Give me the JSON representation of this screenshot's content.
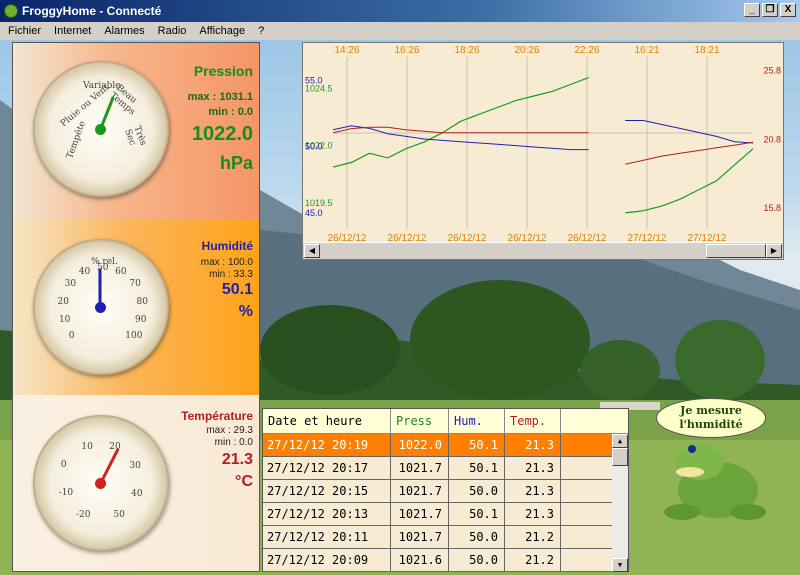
{
  "window": {
    "title": "FroggyHome - Connecté",
    "buttons": [
      "_",
      "❐",
      "X"
    ]
  },
  "menu": [
    "Fichier",
    "Internet",
    "Alarmes",
    "Radio",
    "Affichage",
    "?"
  ],
  "pressure": {
    "title": "Pression",
    "max": "max : 1031.1",
    "min": "min : 0.0",
    "value": "1022.0",
    "unit": "hPa",
    "dial_words": [
      "Tempête",
      "Pluie ou Vent",
      "Variable",
      "Beau Temps",
      "Très Sec"
    ]
  },
  "humidity": {
    "title": "Humidité",
    "max": "max : 100.0",
    "min": "min : 33.3",
    "value": "50.1",
    "unit": "%",
    "dial_label": "% rel.",
    "ticks": [
      "0",
      "10",
      "20",
      "30",
      "40",
      "50",
      "60",
      "70",
      "80",
      "90",
      "100"
    ]
  },
  "temperature": {
    "title": "Température",
    "max": "max : 29.3",
    "min": "min : 0.0",
    "value": "21.3",
    "unit": "°C",
    "ticks": [
      "-20",
      "-10",
      "0",
      "10",
      "20",
      "30",
      "40",
      "50"
    ]
  },
  "chart_data": {
    "type": "line",
    "top_times": [
      "14:26",
      "16:26",
      "18:26",
      "20:26",
      "22:26",
      "16:21",
      "18:21"
    ],
    "bottom_dates": [
      "26/12/12",
      "26/12/12",
      "26/12/12",
      "26/12/12",
      "26/12/12",
      "27/12/12",
      "27/12/12"
    ],
    "left_labels": {
      "pressure": [
        "1024.5",
        "1022.0",
        "1019.5"
      ],
      "humidity": [
        "55.0",
        "50.0",
        "45.0"
      ]
    },
    "right_labels": [
      "25.8",
      "20.8",
      "15.8"
    ],
    "colors": {
      "pressure": "#1a9a1a",
      "humidity": "#2020b0",
      "temperature": "#b02020"
    },
    "series": [
      {
        "name": "Press",
        "values": [
          1021.2,
          1021.4,
          1021.8,
          1021.6,
          1022.0,
          1022.3,
          1022.7,
          1023.2,
          1023.5,
          1023.8,
          1024.1,
          1024.3,
          1024.5,
          1024.8,
          1025.1,
          null,
          1019.2,
          1019.3,
          1019.5,
          1019.8,
          1020.2,
          1020.6,
          1021.3,
          1022.0
        ]
      },
      {
        "name": "Hum.",
        "values": [
          51.5,
          51.8,
          51.6,
          51.2,
          51.0,
          50.8,
          50.7,
          50.6,
          50.5,
          50.4,
          50.3,
          50.2,
          50.1,
          50.0,
          50.0,
          null,
          52.2,
          52.2,
          51.9,
          51.6,
          51.3,
          51.0,
          50.6,
          50.5
        ]
      },
      {
        "name": "Temp.",
        "values": [
          21.5,
          21.8,
          21.9,
          21.9,
          21.7,
          21.6,
          21.5,
          21.5,
          21.5,
          21.5,
          21.5,
          21.5,
          21.5,
          21.5,
          21.5,
          null,
          19.2,
          19.5,
          19.8,
          20.0,
          20.2,
          20.4,
          20.6,
          20.8
        ]
      }
    ]
  },
  "table": {
    "headers": [
      "Date et heure",
      "Press",
      "Hum.",
      "Temp."
    ],
    "header_colors": [
      "#000000",
      "#1a8a1a",
      "#2020b0",
      "#b02020"
    ],
    "rows": [
      [
        "27/12/12 20:19",
        "1022.0",
        "50.1",
        "21.3"
      ],
      [
        "27/12/12 20:17",
        "1021.7",
        "50.1",
        "21.3"
      ],
      [
        "27/12/12 20:15",
        "1021.7",
        "50.0",
        "21.3"
      ],
      [
        "27/12/12 20:13",
        "1021.7",
        "50.1",
        "21.3"
      ],
      [
        "27/12/12 20:11",
        "1021.7",
        "50.0",
        "21.2"
      ],
      [
        "27/12/12 20:09",
        "1021.6",
        "50.0",
        "21.2"
      ]
    ]
  },
  "bubble": {
    "line1": "Je mesure",
    "line2": "l'humidité"
  },
  "needles": {
    "pressure_fraction": 0.58,
    "humidity_fraction": 0.5,
    "temperature_value": 21.3
  }
}
